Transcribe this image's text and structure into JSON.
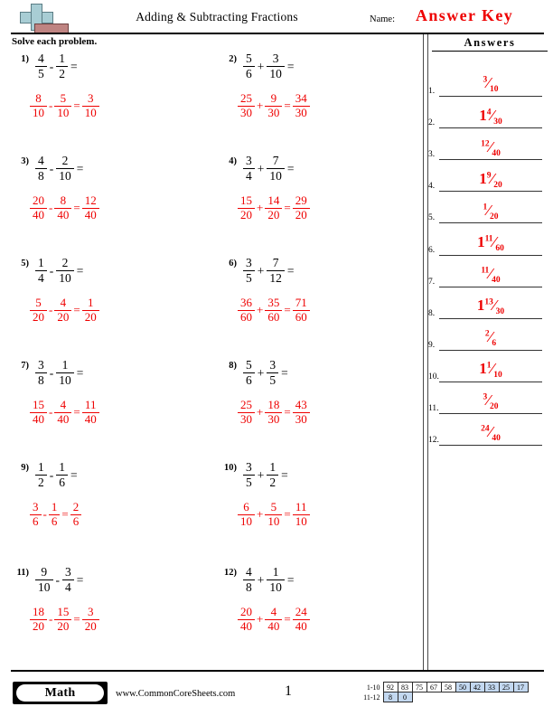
{
  "header": {
    "logo_icon": "math-plus-logo-icon",
    "title": "Adding & Subtracting Fractions",
    "name_label": "Name:",
    "answer_key": "Answer Key"
  },
  "instruction": "Solve each problem.",
  "answers_panel": {
    "heading": "Answers",
    "items": [
      {
        "number": "1.",
        "whole": "",
        "num": "3",
        "den": "10"
      },
      {
        "number": "2.",
        "whole": "1",
        "num": "4",
        "den": "30"
      },
      {
        "number": "3.",
        "whole": "",
        "num": "12",
        "den": "40"
      },
      {
        "number": "4.",
        "whole": "1",
        "num": "9",
        "den": "20"
      },
      {
        "number": "5.",
        "whole": "",
        "num": "1",
        "den": "20"
      },
      {
        "number": "6.",
        "whole": "1",
        "num": "11",
        "den": "60"
      },
      {
        "number": "7.",
        "whole": "",
        "num": "11",
        "den": "40"
      },
      {
        "number": "8.",
        "whole": "1",
        "num": "13",
        "den": "30"
      },
      {
        "number": "9.",
        "whole": "",
        "num": "2",
        "den": "6"
      },
      {
        "number": "10.",
        "whole": "1",
        "num": "1",
        "den": "10"
      },
      {
        "number": "11.",
        "whole": "",
        "num": "3",
        "den": "20"
      },
      {
        "number": "12.",
        "whole": "",
        "num": "24",
        "den": "40"
      }
    ]
  },
  "problems": [
    {
      "number": "1)",
      "a_num": "4",
      "a_den": "5",
      "op": "-",
      "b_num": "1",
      "b_den": "2",
      "w_a_num": "8",
      "w_a_den": "10",
      "w_b_num": "5",
      "w_b_den": "10",
      "w_r_num": "3",
      "w_r_den": "10"
    },
    {
      "number": "2)",
      "a_num": "5",
      "a_den": "6",
      "op": "+",
      "b_num": "3",
      "b_den": "10",
      "w_a_num": "25",
      "w_a_den": "30",
      "w_b_num": "9",
      "w_b_den": "30",
      "w_r_num": "34",
      "w_r_den": "30"
    },
    {
      "number": "3)",
      "a_num": "4",
      "a_den": "8",
      "op": "-",
      "b_num": "2",
      "b_den": "10",
      "w_a_num": "20",
      "w_a_den": "40",
      "w_b_num": "8",
      "w_b_den": "40",
      "w_r_num": "12",
      "w_r_den": "40"
    },
    {
      "number": "4)",
      "a_num": "3",
      "a_den": "4",
      "op": "+",
      "b_num": "7",
      "b_den": "10",
      "w_a_num": "15",
      "w_a_den": "20",
      "w_b_num": "14",
      "w_b_den": "20",
      "w_r_num": "29",
      "w_r_den": "20"
    },
    {
      "number": "5)",
      "a_num": "1",
      "a_den": "4",
      "op": "-",
      "b_num": "2",
      "b_den": "10",
      "w_a_num": "5",
      "w_a_den": "20",
      "w_b_num": "4",
      "w_b_den": "20",
      "w_r_num": "1",
      "w_r_den": "20"
    },
    {
      "number": "6)",
      "a_num": "3",
      "a_den": "5",
      "op": "+",
      "b_num": "7",
      "b_den": "12",
      "w_a_num": "36",
      "w_a_den": "60",
      "w_b_num": "35",
      "w_b_den": "60",
      "w_r_num": "71",
      "w_r_den": "60"
    },
    {
      "number": "7)",
      "a_num": "3",
      "a_den": "8",
      "op": "-",
      "b_num": "1",
      "b_den": "10",
      "w_a_num": "15",
      "w_a_den": "40",
      "w_b_num": "4",
      "w_b_den": "40",
      "w_r_num": "11",
      "w_r_den": "40"
    },
    {
      "number": "8)",
      "a_num": "5",
      "a_den": "6",
      "op": "+",
      "b_num": "3",
      "b_den": "5",
      "w_a_num": "25",
      "w_a_den": "30",
      "w_b_num": "18",
      "w_b_den": "30",
      "w_r_num": "43",
      "w_r_den": "30"
    },
    {
      "number": "9)",
      "a_num": "1",
      "a_den": "2",
      "op": "-",
      "b_num": "1",
      "b_den": "6",
      "w_a_num": "3",
      "w_a_den": "6",
      "w_b_num": "1",
      "w_b_den": "6",
      "w_r_num": "2",
      "w_r_den": "6"
    },
    {
      "number": "10)",
      "a_num": "3",
      "a_den": "5",
      "op": "+",
      "b_num": "1",
      "b_den": "2",
      "w_a_num": "6",
      "w_a_den": "10",
      "w_b_num": "5",
      "w_b_den": "10",
      "w_r_num": "11",
      "w_r_den": "10"
    },
    {
      "number": "11)",
      "a_num": "9",
      "a_den": "10",
      "op": "-",
      "b_num": "3",
      "b_den": "4",
      "w_a_num": "18",
      "w_a_den": "20",
      "w_b_num": "15",
      "w_b_den": "20",
      "w_r_num": "3",
      "w_r_den": "20"
    },
    {
      "number": "12)",
      "a_num": "4",
      "a_den": "8",
      "op": "+",
      "b_num": "1",
      "b_den": "10",
      "w_a_num": "20",
      "w_a_den": "40",
      "w_b_num": "4",
      "w_b_den": "40",
      "w_r_num": "24",
      "w_r_den": "40"
    }
  ],
  "equals": "=",
  "footer": {
    "subject_badge": "Math",
    "site_url": "www.CommonCoreSheets.com",
    "page_number": "1",
    "score_table": {
      "row1_label": "1-10",
      "row1_values": [
        "92",
        "83",
        "75",
        "67",
        "58",
        "50",
        "42",
        "33",
        "25",
        "17"
      ],
      "row1_highlight": [
        false,
        false,
        false,
        false,
        false,
        true,
        true,
        true,
        true,
        true
      ],
      "row2_label": "11-12",
      "row2_values": [
        "8",
        "0"
      ],
      "row2_highlight": [
        true,
        true
      ],
      "highlight_color": "#c3d8f0"
    }
  }
}
